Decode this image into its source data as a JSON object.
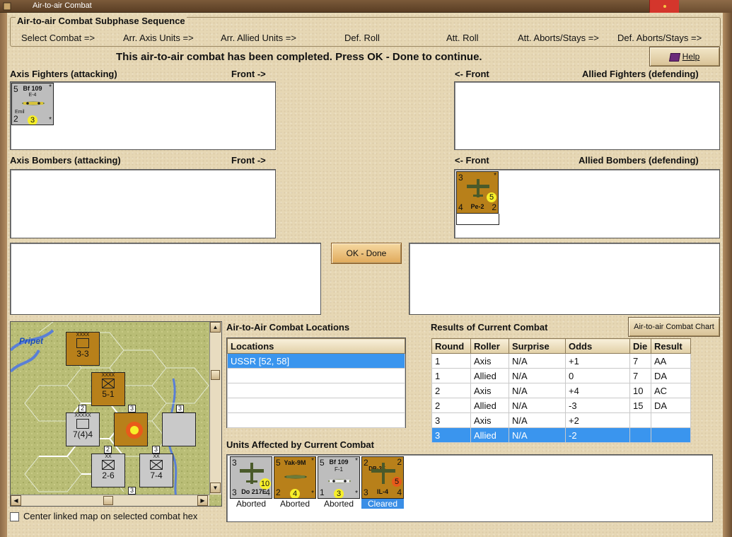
{
  "window": {
    "title": "Air-to-air Combat"
  },
  "sequence": {
    "title": "Air-to-air Combat Subphase Sequence",
    "steps": [
      "Select Combat =>",
      "Arr. Axis Units =>",
      "Arr. Allied Units =>",
      "Def. Roll",
      "Att. Roll",
      "Att. Aborts/Stays =>",
      "Def. Aborts/Stays =>"
    ]
  },
  "status_message": "This air-to-air combat has been completed.  Press OK - Done to continue.",
  "buttons": {
    "help": "Help",
    "ok_done": "OK - Done",
    "air_chart": "Air-to-air Combat Chart"
  },
  "panels": {
    "axis_fighters": {
      "label": "Axis Fighters (attacking)",
      "front": "Front ->"
    },
    "allied_fighters": {
      "label": "Allied Fighters (defending)",
      "front": "<- Front"
    },
    "axis_bombers": {
      "label": "Axis Bombers (attacking)",
      "front": "Front ->"
    },
    "allied_bombers": {
      "label": "Allied Bombers (defending)",
      "front": "<- Front"
    }
  },
  "units": {
    "bf109e": {
      "name": "Bf 109",
      "variant": "E-4",
      "nick": "Emil",
      "attack": "5",
      "defense": "2",
      "range": "3",
      "star": "*",
      "star2": "*"
    },
    "pe2": {
      "name": "Pe-2",
      "attack": "3",
      "defense": "4",
      "bomb": "2",
      "range": "5",
      "star": "*"
    },
    "do217": {
      "name": "Do 217E",
      "attack": "3",
      "defense": "3",
      "bomb": "4",
      "range": "10"
    },
    "yak9m": {
      "name": "Yak-9M",
      "attack": "5",
      "defense": "2",
      "range": "4",
      "star": "*",
      "star2": "*"
    },
    "bf109f": {
      "name": "Bf 109",
      "variant": "F-1",
      "attack": "5",
      "defense": "1",
      "range": "3",
      "star": "*",
      "star2": "*"
    },
    "il4": {
      "name": "IL-4",
      "top_name": "DB-3F",
      "attack": "2",
      "defense": "3",
      "bomb": "4",
      "range": "5",
      "star": "2"
    }
  },
  "map": {
    "region_label": "Pripet",
    "units": [
      {
        "size": "XXXX",
        "strength": "3-3"
      },
      {
        "size": "XXXX",
        "strength": "5-1"
      },
      {
        "size": "XXXXX",
        "strength": "7(4)4"
      },
      {
        "size": "XX",
        "strength": "2-6"
      },
      {
        "size": "XX",
        "strength": "7-4"
      }
    ],
    "stack_counts": [
      "2",
      "3",
      "3",
      "2",
      "3",
      "3"
    ]
  },
  "center_map": {
    "label": "Center linked map on selected combat hex",
    "checked": false
  },
  "locations": {
    "title": "Air-to-Air Combat Locations",
    "header": "Locations",
    "rows": [
      "USSR [52, 58]"
    ]
  },
  "results": {
    "title": "Results of Current Combat",
    "headers": [
      "Round",
      "Roller",
      "Surprise",
      "Odds",
      "Die",
      "Result"
    ],
    "rows": [
      [
        "1",
        "Axis",
        "N/A",
        "+1",
        "7",
        "AA"
      ],
      [
        "1",
        "Allied",
        "N/A",
        "0",
        "7",
        "DA"
      ],
      [
        "2",
        "Axis",
        "N/A",
        "+4",
        "10",
        "AC"
      ],
      [
        "2",
        "Allied",
        "N/A",
        "-3",
        "15",
        "DA"
      ],
      [
        "3",
        "Axis",
        "N/A",
        "+2",
        "",
        ""
      ],
      [
        "3",
        "Allied",
        "N/A",
        "-2",
        "",
        ""
      ]
    ],
    "selected_row": 5
  },
  "affected": {
    "title": "Units Affected by Current Combat",
    "statuses": [
      "Aborted",
      "Aborted",
      "Aborted",
      "Cleared"
    ]
  },
  "colors": {
    "selection": "#3a95ee",
    "counter_axis": "#bdbdbd",
    "counter_allied": "#b8801a",
    "range_circle": "#f7ef2a"
  }
}
